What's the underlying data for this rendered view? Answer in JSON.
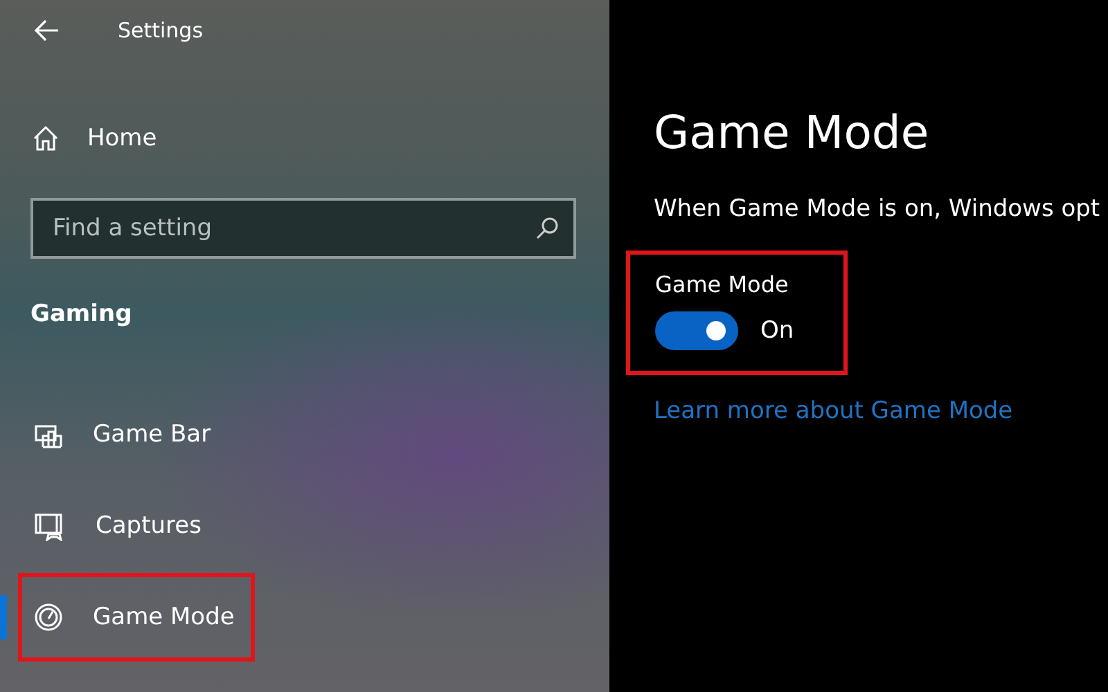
{
  "window": {
    "title": "Settings"
  },
  "sidebar": {
    "home": "Home",
    "search": {
      "placeholder": "Find a setting"
    },
    "section": "Gaming",
    "items": [
      {
        "label": "Game Bar",
        "kind": "gamebar",
        "selected": false,
        "highlighted": false
      },
      {
        "label": "Captures",
        "kind": "captures",
        "selected": false,
        "highlighted": false
      },
      {
        "label": "Game Mode",
        "kind": "gamemode",
        "selected": true,
        "highlighted": true
      }
    ]
  },
  "content": {
    "title": "Game Mode",
    "description": "When Game Mode is on, Windows opt",
    "toggle": {
      "label": "Game Mode",
      "on": true,
      "state_text": "On",
      "highlighted": true
    },
    "link": "Learn more about Game Mode"
  }
}
